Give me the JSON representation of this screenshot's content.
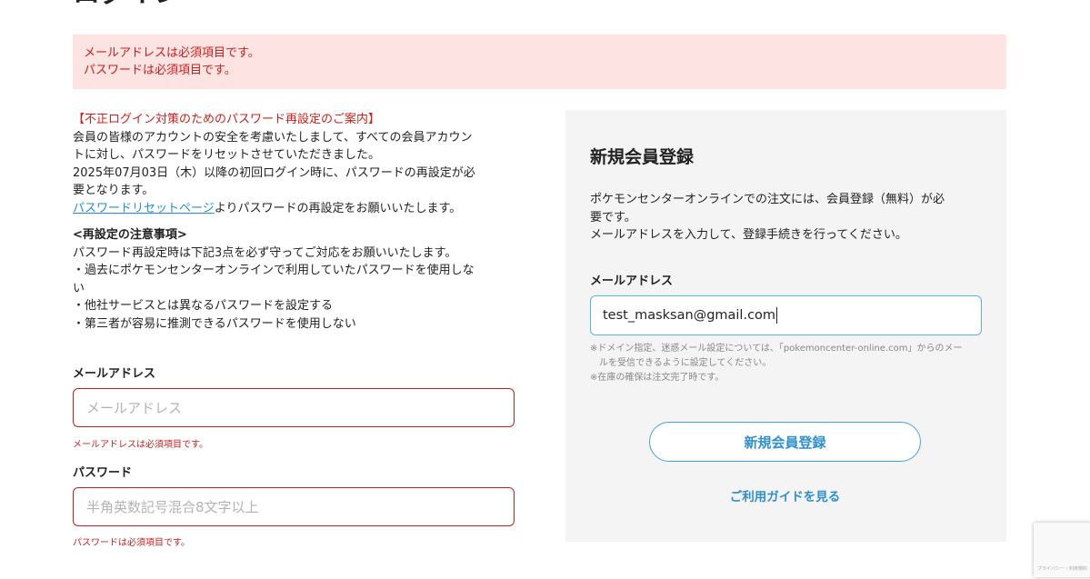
{
  "page": {
    "title": "ログイン"
  },
  "errors": {
    "email_required": "メールアドレスは必須項目です。",
    "password_required": "パスワードは必須項目です。"
  },
  "notice": {
    "heading": "【不正ログイン対策のためのパスワード再設定のご案内】",
    "line1": "会員の皆様のアカウントの安全を考慮いたしまして、すべての会員アカウン",
    "line2": "トに対し、パスワードをリセットさせていただきました。",
    "line3": "2025年07月03日（木）以降の初回ログイン時に、パスワードの再設定が必",
    "line4": "要となります。",
    "link": "パスワードリセットページ",
    "link_suffix": "よりパスワードの再設定をお願いいたします。",
    "caution_heading": "<再設定の注意事項>",
    "caution_intro": "パスワード再設定時は下記3点を必ず守ってご対応をお願いいたします。",
    "bullet1a": "・過去にポケモンセンターオンラインで利用していたパスワードを使用しな",
    "bullet1b": "い",
    "bullet2": "・他社サービスとは異なるパスワードを設定する",
    "bullet3": "・第三者が容易に推測できるパスワードを使用しない"
  },
  "login_form": {
    "email_label": "メールアドレス",
    "email_placeholder": "メールアドレス",
    "email_error": "メールアドレスは必須項目です。",
    "password_label": "パスワード",
    "password_placeholder": "半角英数記号混合8文字以上",
    "password_error": "パスワードは必須項目です。"
  },
  "register": {
    "title": "新規会員登録",
    "desc1": "ポケモンセンターオンラインでの注文には、会員登録（無料）が必",
    "desc2": "要です。",
    "desc3": "メールアドレスを入力して、登録手続きを行ってください。",
    "email_label": "メールアドレス",
    "email_value": "test_masksan@gmail.com",
    "note1": "※ドメイン指定、迷惑メール設定については、「pokemoncenter-online.com」からのメー",
    "note2": "ルを受信できるように設定してください。",
    "note3": "※在庫の確保は注文完了時です。",
    "button_label": "新規会員登録",
    "guide_link": "ご利用ガイドを見る"
  },
  "recaptcha": {
    "text": "プライバシー・利用規約"
  }
}
